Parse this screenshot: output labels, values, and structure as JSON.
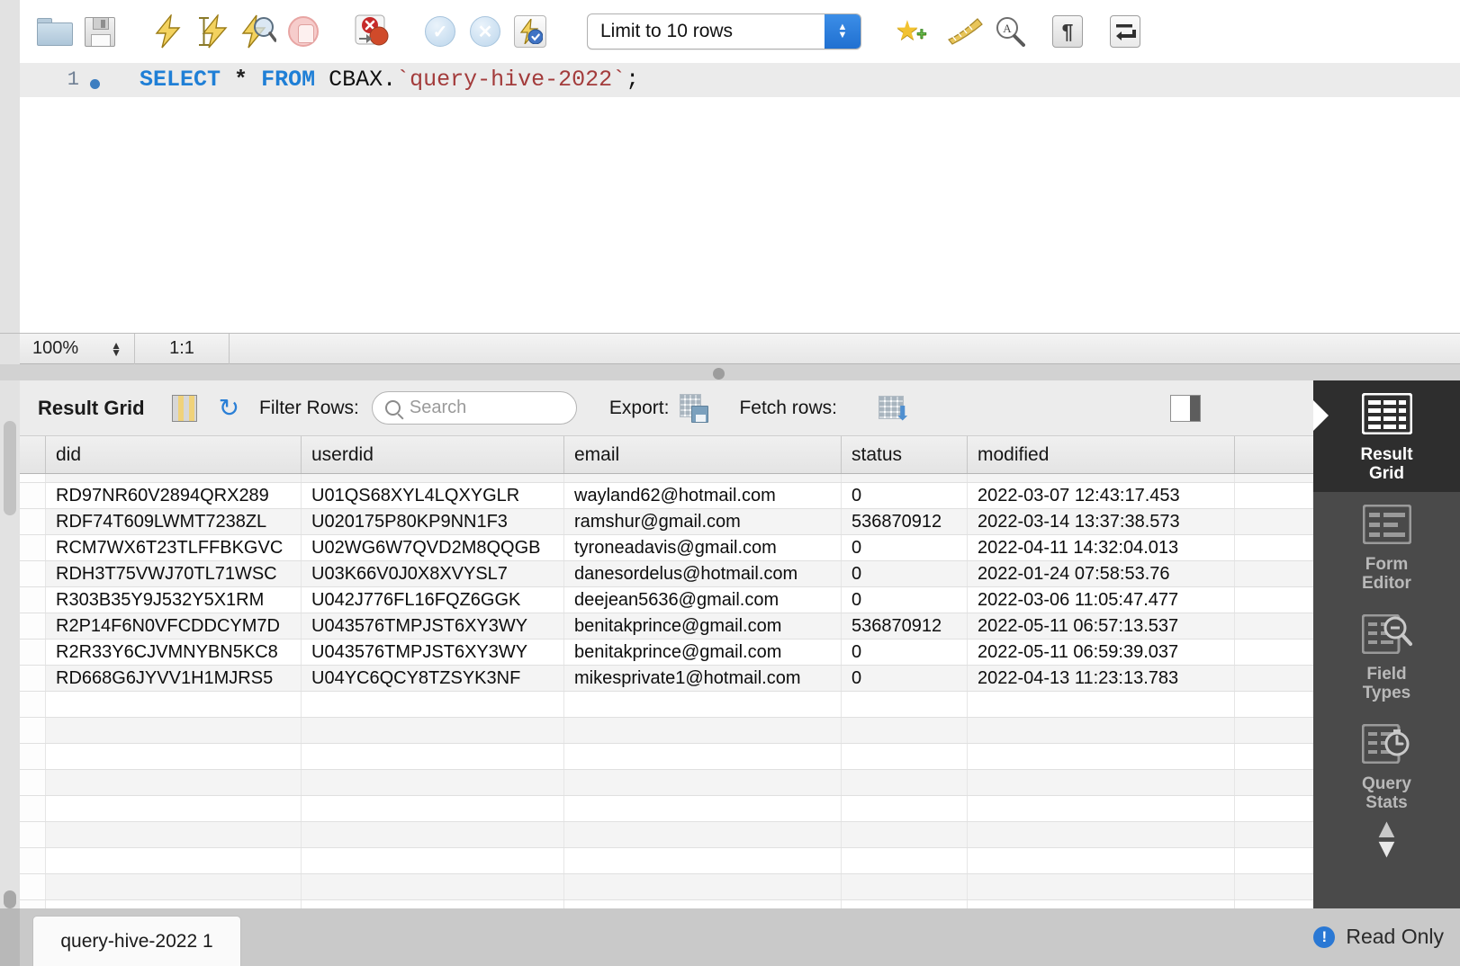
{
  "toolbar": {
    "icons": [
      {
        "name": "open-file-icon",
        "title": "Open SQL Script"
      },
      {
        "name": "save-script-icon",
        "title": "Save Script"
      },
      {
        "name": "execute-icon",
        "title": "Execute"
      },
      {
        "name": "execute-current-statement-icon",
        "title": "Execute Current Statement"
      },
      {
        "name": "explain-icon",
        "title": "Explain Current Statement"
      },
      {
        "name": "stop-icon",
        "title": "Stop"
      },
      {
        "name": "toggle-stop-on-error-icon",
        "title": "Toggle stop on error"
      },
      {
        "name": "commit-icon",
        "title": "Commit"
      },
      {
        "name": "rollback-icon",
        "title": "Rollback"
      },
      {
        "name": "autocommit-icon",
        "title": "Toggle Autocommit"
      },
      {
        "name": "add-snippet-icon",
        "title": "Save snippet"
      },
      {
        "name": "beautify-icon",
        "title": "Beautify SQL"
      },
      {
        "name": "find-icon",
        "title": "Find"
      },
      {
        "name": "invisible-chars-icon",
        "title": "Toggle invisible characters"
      },
      {
        "name": "wrap-lines-icon",
        "title": "Toggle wrapping"
      }
    ],
    "limit_value": "Limit to 10 rows"
  },
  "editor": {
    "line_number": "1",
    "sql": {
      "select": "SELECT",
      "star": "*",
      "from": "FROM",
      "schema": "CBAX.",
      "table": "`query-hive-2022`",
      "semicolon": ";"
    }
  },
  "editor_status": {
    "zoom": "100%",
    "cursor": "1:1"
  },
  "result_toolbar": {
    "title": "Result Grid",
    "filter_label": "Filter Rows:",
    "search_placeholder": "Search",
    "export_label": "Export:",
    "fetch_label": "Fetch rows:"
  },
  "grid": {
    "columns": [
      "did",
      "userdid",
      "email",
      "status",
      "modified"
    ],
    "rows": [
      {
        "did": "RD97NR60V2894QRX289",
        "userdid": "U01QS68XYL4LQXYGLR",
        "email": "wayland62@hotmail.com",
        "status": "0",
        "modified": "2022-03-07 12:43:17.453"
      },
      {
        "did": "RDF74T609LWMT7238ZL",
        "userdid": "U020175P80KP9NN1F3",
        "email": "ramshur@gmail.com",
        "status": "536870912",
        "modified": "2022-03-14 13:37:38.573"
      },
      {
        "did": "RCM7WX6T23TLFFBKGVC",
        "userdid": "U02WG6W7QVD2M8QQGB",
        "email": "tyroneadavis@gmail.com",
        "status": "0",
        "modified": "2022-04-11 14:32:04.013"
      },
      {
        "did": "RDH3T75VWJ70TL71WSC",
        "userdid": "U03K66V0J0X8XVYSL7",
        "email": "danesordelus@hotmail.com",
        "status": "0",
        "modified": "2022-01-24 07:58:53.76"
      },
      {
        "did": "R303B35Y9J532Y5X1RM",
        "userdid": "U042J776FL16FQZ6GGK",
        "email": "deejean5636@gmail.com",
        "status": "0",
        "modified": "2022-03-06 11:05:47.477"
      },
      {
        "did": "R2P14F6N0VFCDDCYM7D",
        "userdid": "U043576TMPJST6XY3WY",
        "email": "benitakprince@gmail.com",
        "status": "536870912",
        "modified": "2022-05-11 06:57:13.537"
      },
      {
        "did": "R2R33Y6CJVMNYBN5KC8",
        "userdid": "U043576TMPJST6XY3WY",
        "email": "benitakprince@gmail.com",
        "status": "0",
        "modified": "2022-05-11 06:59:39.037"
      },
      {
        "did": "RD668G6JYVV1H1MJRS5",
        "userdid": "U04YC6QCY8TZSYK3NF",
        "email": "mikesprivate1@hotmail.com",
        "status": "0",
        "modified": "2022-04-13 11:23:13.783"
      }
    ]
  },
  "sidebar": {
    "items": [
      {
        "label_line1": "Result",
        "label_line2": "Grid",
        "active": true
      },
      {
        "label_line1": "Form",
        "label_line2": "Editor",
        "active": false
      },
      {
        "label_line1": "Field",
        "label_line2": "Types",
        "active": false
      },
      {
        "label_line1": "Query",
        "label_line2": "Stats",
        "active": false
      }
    ]
  },
  "bottom": {
    "tab_label": "query-hive-2022 1",
    "read_only": "Read Only",
    "info_glyph": "!"
  }
}
